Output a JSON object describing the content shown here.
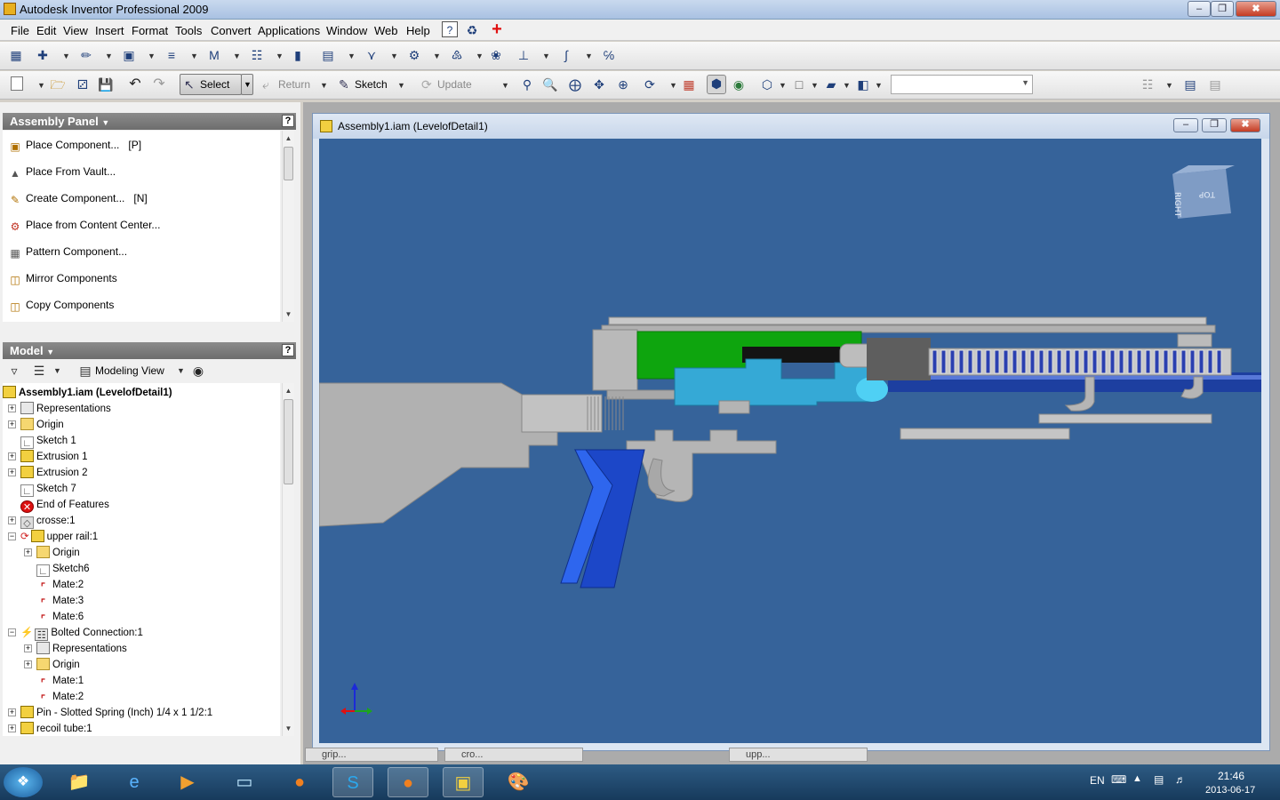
{
  "window": {
    "title": "Autodesk Inventor Professional 2009",
    "min": "‒",
    "max": "❐",
    "close": "✖"
  },
  "menu": [
    "File",
    "Edit",
    "View",
    "Insert",
    "Format",
    "Tools",
    "Convert",
    "Applications",
    "Window",
    "Web",
    "Help"
  ],
  "toolbar2": {
    "select": "Select",
    "return": "Return",
    "sketch": "Sketch",
    "update": "Update"
  },
  "assembly_panel": {
    "title": "Assembly Panel",
    "items": [
      {
        "label": "Place Component...",
        "shortcut": "[P]"
      },
      {
        "label": "Place From Vault...",
        "shortcut": ""
      },
      {
        "label": "Create Component...",
        "shortcut": "[N]"
      },
      {
        "label": "Place from Content Center...",
        "shortcut": ""
      },
      {
        "label": "Pattern Component...",
        "shortcut": ""
      },
      {
        "label": "Mirror Components",
        "shortcut": ""
      },
      {
        "label": "Copy Components",
        "shortcut": ""
      }
    ]
  },
  "model_panel": {
    "title": "Model",
    "view": "Modeling View",
    "tree": [
      "Assembly1.iam (LevelofDetail1)",
      "Representations",
      "Origin",
      "Sketch 1",
      "Extrusion 1",
      "Extrusion 2",
      "Sketch 7",
      "End of Features",
      "crosse:1",
      "upper rail:1",
      "Origin",
      "Sketch6",
      "Mate:2",
      "Mate:3",
      "Mate:6",
      "Bolted Connection:1",
      "Representations",
      "Origin",
      "Mate:1",
      "Mate:2",
      "Pin - Slotted Spring (Inch) 1/4 x 1 1/2:1",
      "recoil tube:1"
    ]
  },
  "document": {
    "title": "Assembly1.iam (LevelofDetail1)",
    "viewcube": {
      "right": "RIGHT",
      "top": "TOP"
    }
  },
  "doc_tabs": [
    "grip...",
    "cro...",
    "upp..."
  ],
  "taskbar": {
    "lang": "EN",
    "time": "21:46",
    "date": "2013-06-17"
  },
  "colors": {
    "viewport": "#36639a",
    "green_part": "#0ea50e",
    "cyan_part": "#35a9d6",
    "blue_grip": "#1c47c8",
    "gray_part": "#b4b4b4"
  }
}
